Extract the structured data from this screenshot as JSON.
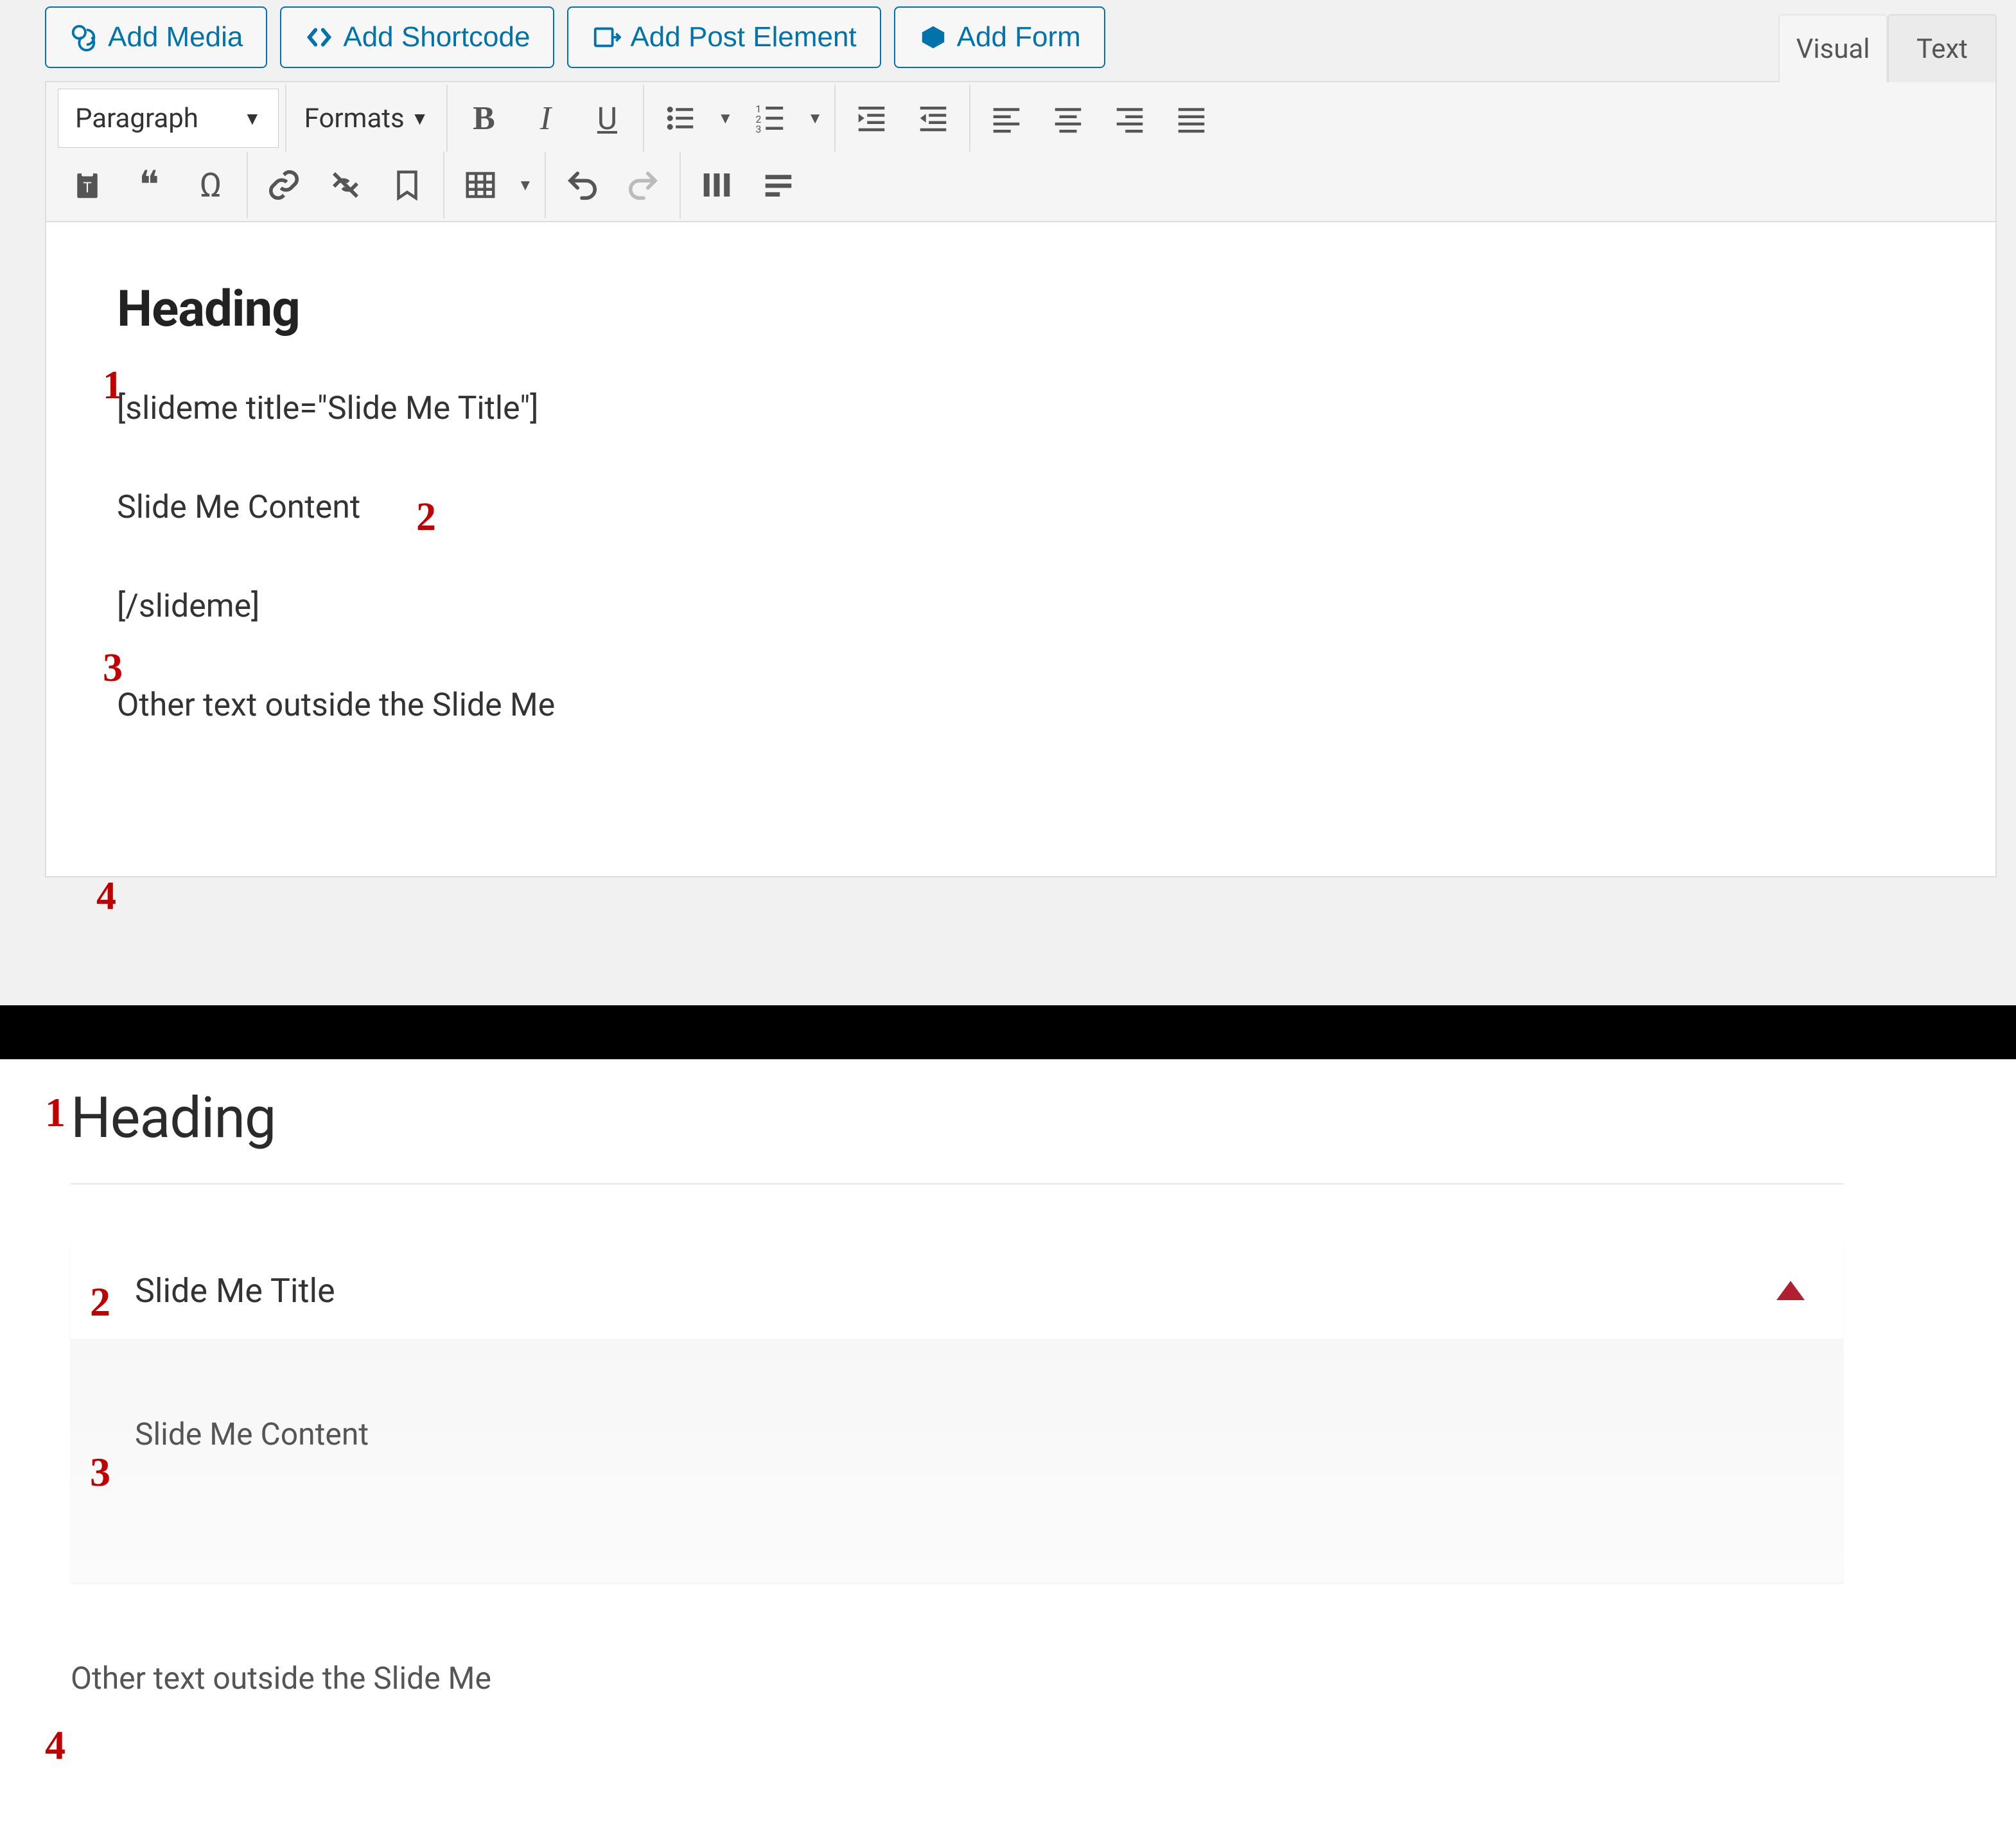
{
  "editor": {
    "media_buttons": {
      "add_media": "Add Media",
      "add_shortcode": "Add Shortcode",
      "add_post_element": "Add Post Element",
      "add_form": "Add Form"
    },
    "tabs": {
      "visual": "Visual",
      "text": "Text",
      "active": "visual"
    },
    "toolbar": {
      "block_format": "Paragraph",
      "formats_label": "Formats"
    },
    "content": {
      "heading": "Heading",
      "shortcode_open": "[slideme title=\"Slide Me Title\"]",
      "slide_content": "Slide Me Content",
      "shortcode_close": "[/slideme]",
      "outside_text": "Other text outside the Slide Me"
    }
  },
  "preview": {
    "heading": "Heading",
    "slide_title": "Slide Me Title",
    "slide_content": "Slide Me Content",
    "outside_text": "Other text outside the Slide Me"
  },
  "annotations": {
    "n1": "1",
    "n2": "2",
    "n3": "3",
    "n4": "4"
  },
  "colors": {
    "wp_blue": "#0073aa",
    "ann_red": "#c00000",
    "arrow_red": "#b02031"
  }
}
